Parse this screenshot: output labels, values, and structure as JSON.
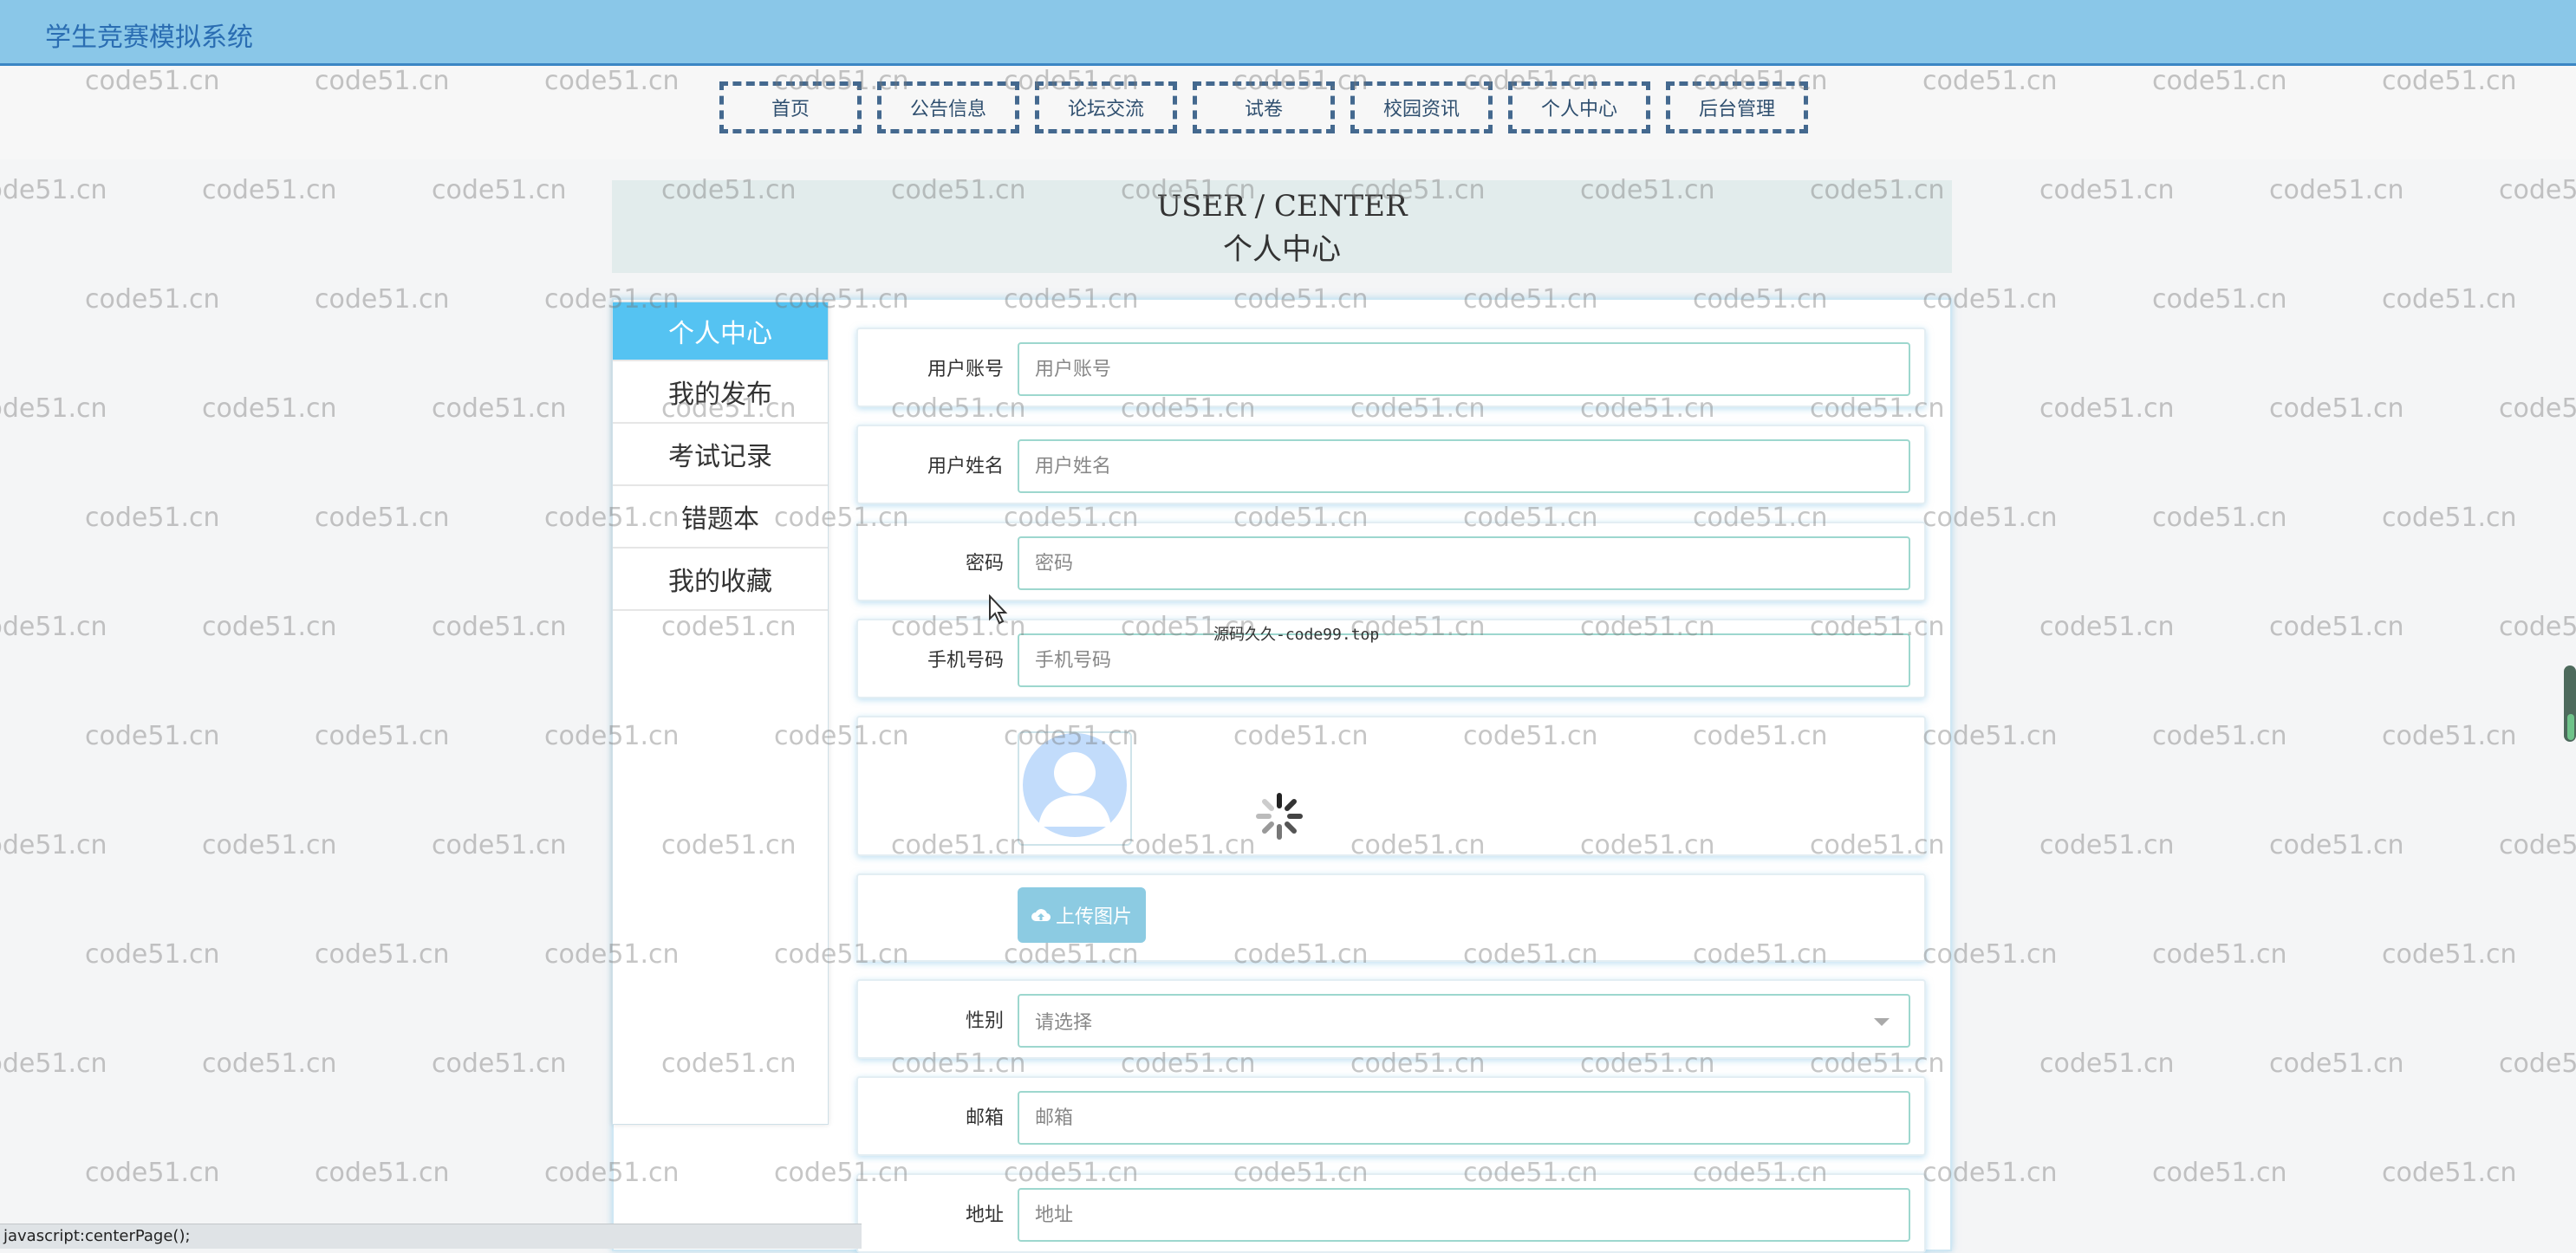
{
  "header": {
    "title": "学生竞赛模拟系统"
  },
  "nav": {
    "items": [
      {
        "label": "首页"
      },
      {
        "label": "公告信息"
      },
      {
        "label": "论坛交流"
      },
      {
        "label": "试卷"
      },
      {
        "label": "校园资讯"
      },
      {
        "label": "个人中心"
      },
      {
        "label": "后台管理"
      }
    ]
  },
  "center": {
    "title_en": "USER / CENTER",
    "title_cn": "个人中心"
  },
  "sidebar": {
    "items": [
      {
        "label": "个人中心",
        "active": true
      },
      {
        "label": "我的发布"
      },
      {
        "label": "考试记录"
      },
      {
        "label": "错题本"
      },
      {
        "label": "我的收藏"
      }
    ]
  },
  "form": {
    "account": {
      "label": "用户账号",
      "placeholder": "用户账号"
    },
    "name": {
      "label": "用户姓名",
      "placeholder": "用户姓名"
    },
    "password": {
      "label": "密码",
      "placeholder": "密码"
    },
    "phone": {
      "label": "手机号码",
      "placeholder": "手机号码"
    },
    "upload_label": "上传图片",
    "gender": {
      "label": "性别",
      "selected": "请选择"
    },
    "email": {
      "label": "邮箱",
      "placeholder": "邮箱"
    },
    "address": {
      "label": "地址",
      "placeholder": "地址"
    }
  },
  "overlay_text": "源码久久-code99.top",
  "watermark": "code51.cn",
  "statusbar": "javascript:centerPage();",
  "colors": {
    "topbar": "#8ac7e8",
    "accent": "#55c3f2",
    "nav_border": "#44698f",
    "upload_button": "#8ccbe2"
  },
  "icons": [
    "user-avatar-icon",
    "cloud-upload-icon",
    "loading-spinner-icon",
    "chevron-down-icon",
    "mouse-pointer-icon"
  ]
}
